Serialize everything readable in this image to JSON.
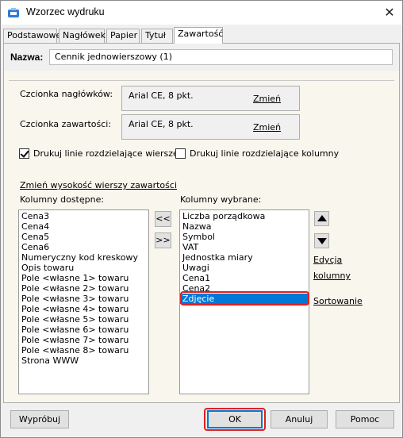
{
  "window": {
    "title": "Wzorzec wydruku",
    "close_glyph": "✕",
    "app_icon": "printer-template-icon"
  },
  "tabs": [
    {
      "label": "Podstawowe",
      "active": false
    },
    {
      "label": "Nagłówek",
      "active": false
    },
    {
      "label": "Papier",
      "active": false
    },
    {
      "label": "Tytuł",
      "active": false
    },
    {
      "label": "Zawartość",
      "active": true
    }
  ],
  "nazwa": {
    "label": "Nazwa:",
    "value": "Cennik jednowierszowy (1)"
  },
  "fonts": {
    "header": {
      "label": "Czcionka nagłówków:",
      "value": "Arial CE, 8 pkt.",
      "change": "Zmień"
    },
    "content": {
      "label": "Czcionka zawartości:",
      "value": "Arial CE, 8 pkt.",
      "change": "Zmień"
    }
  },
  "checkboxes": {
    "rows": {
      "label": "Drukuj linie rozdzielające wiersze",
      "checked": true
    },
    "cols": {
      "label": "Drukuj linie rozdzielające kolumny",
      "checked": false
    }
  },
  "row_height_link": "Zmień wysokość wierszy zawartości",
  "available": {
    "label": "Kolumny dostępne:",
    "items": [
      "Cena3",
      "Cena4",
      "Cena5",
      "Cena6",
      "Numeryczny kod kreskowy",
      "Opis towaru",
      "Pole <własne 1> towaru",
      "Pole <własne 2> towaru",
      "Pole <własne 3> towaru",
      "Pole <własne 4> towaru",
      "Pole <własne 5> towaru",
      "Pole <własne 6> towaru",
      "Pole <własne 7> towaru",
      "Pole <własne 8> towaru",
      "Strona WWW"
    ]
  },
  "selected": {
    "label": "Kolumny wybrane:",
    "items": [
      "Liczba porządkowa",
      "Nazwa",
      "Symbol",
      "VAT",
      "Jednostka miary",
      "Uwagi",
      "Cena1",
      "Cena2",
      "Zdjęcie"
    ],
    "selected_item": "Zdjęcie"
  },
  "move": {
    "left": "<<",
    "right": ">>"
  },
  "side_links": {
    "edit_line1": "Edycja",
    "edit_line2": "kolumny",
    "sort": "Sortowanie"
  },
  "buttons": {
    "try": "Wypróbuj",
    "ok": "OK",
    "cancel": "Anuluj",
    "help": "Pomoc"
  },
  "colors": {
    "selection": "#0078d7",
    "highlight": "#e02020"
  }
}
